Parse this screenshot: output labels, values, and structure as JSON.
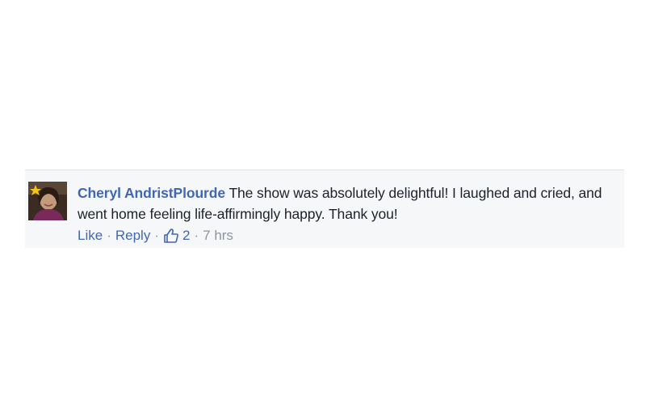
{
  "comment": {
    "author": "Cheryl AndristPlourde",
    "text": "The show was absolutely delightful! I laughed and cried, and went home feeling life-affirmingly happy. Thank you!",
    "actions": {
      "like_label": "Like",
      "reply_label": "Reply",
      "separator": "·",
      "like_count": "2",
      "timestamp": "7 hrs"
    },
    "icons": {
      "avatar": "profile-photo",
      "like_count_icon": "thumbs-up-icon"
    },
    "colors": {
      "link": "#4267b2",
      "text": "#1d2129",
      "meta": "#90949c",
      "background": "#f6f7f9"
    }
  }
}
